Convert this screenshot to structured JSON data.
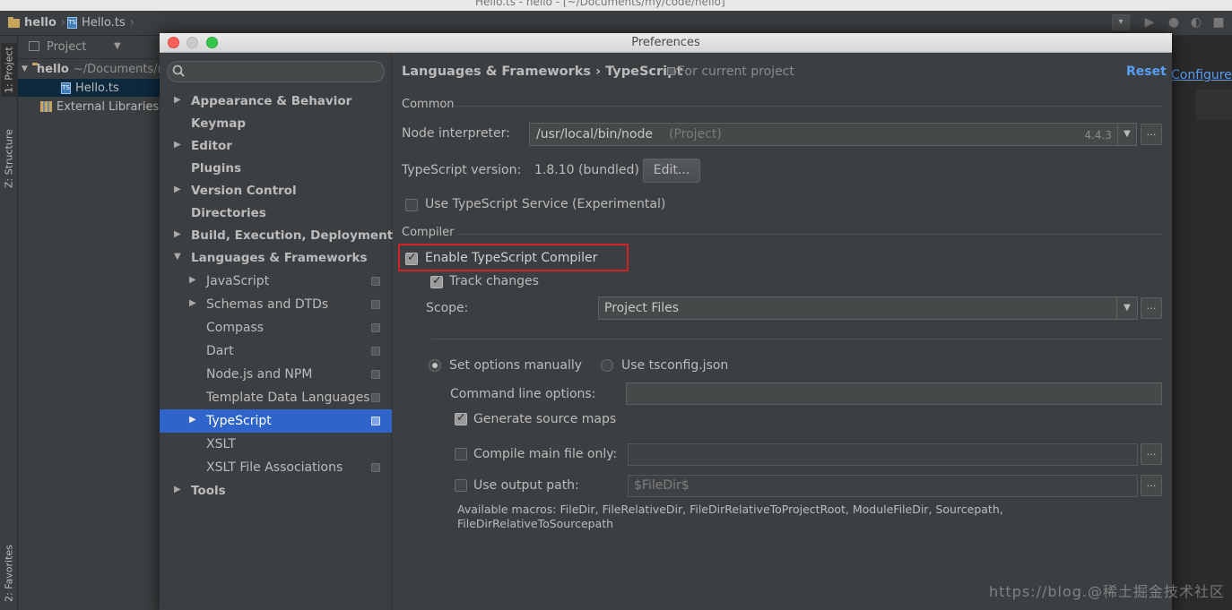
{
  "os_window": {
    "title": "Hello.ts - hello - [~/Documents/my/code/hello]"
  },
  "ide": {
    "breadcrumbs": [
      {
        "label": "hello"
      },
      {
        "label": "Hello.ts"
      }
    ],
    "left_tabs": {
      "project": "1: Project",
      "structure": "Z: Structure",
      "favorites": "2: Favorites"
    },
    "project_panel": {
      "header": "Project",
      "tree": {
        "root_name": "hello",
        "root_path": "~/Documents/my/code/hello",
        "file": "Hello.ts",
        "libraries": "External Libraries"
      }
    },
    "configure_link": "Configure"
  },
  "dialog": {
    "title": "Preferences",
    "sidebar": {
      "items": [
        {
          "label": "Appearance & Behavior"
        },
        {
          "label": "Keymap"
        },
        {
          "label": "Editor"
        },
        {
          "label": "Plugins"
        },
        {
          "label": "Version Control"
        },
        {
          "label": "Directories"
        },
        {
          "label": "Build, Execution, Deployment"
        },
        {
          "label": "Languages & Frameworks"
        },
        {
          "label": "JavaScript"
        },
        {
          "label": "Schemas and DTDs"
        },
        {
          "label": "Compass"
        },
        {
          "label": "Dart"
        },
        {
          "label": "Node.js and NPM"
        },
        {
          "label": "Template Data Languages"
        },
        {
          "label": "TypeScript"
        },
        {
          "label": "XSLT"
        },
        {
          "label": "XSLT File Associations"
        },
        {
          "label": "Tools"
        }
      ],
      "selected": "TypeScript"
    },
    "content": {
      "breadcrumb": "Languages & Frameworks › TypeScript",
      "scope_note": "For current project",
      "reset_label": "Reset",
      "common_header": "Common",
      "node_label": "Node interpreter:",
      "node_value": "/usr/local/bin/node",
      "node_scope": "(Project)",
      "node_version": "4.4.3",
      "ts_version_label": "TypeScript version:",
      "ts_version_value": "1.8.10 (bundled)",
      "edit_label": "Edit...",
      "use_service_label": "Use TypeScript Service (Experimental)",
      "compiler_header": "Compiler",
      "enable_compiler_label": "Enable TypeScript Compiler",
      "track_changes_label": "Track changes",
      "scope_label": "Scope:",
      "scope_value": "Project Files",
      "set_manually_label": "Set options manually",
      "use_tsconfig_label": "Use tsconfig.json",
      "cmd_options_label": "Command line options:",
      "cmd_options_value": "",
      "gen_maps_label": "Generate source maps",
      "compile_main_label": "Compile main file only:",
      "compile_main_value": "",
      "output_path_label": "Use output path:",
      "output_path_value": "$FileDir$",
      "macros_line1": "Available macros: FileDir, FileRelativeDir, FileDirRelativeToProjectRoot, ModuleFileDir, Sourcepath,",
      "macros_line2": "FileDirRelativeToSourcepath",
      "state": {
        "use_service": false,
        "enable_compiler": true,
        "track_changes": true,
        "set_manually": true,
        "use_tsconfig": false,
        "gen_maps": true,
        "compile_main": false,
        "output_path": false
      }
    }
  },
  "watermark": "https://blog.@稀土掘金技术社区",
  "colors": {
    "selection": "#2f65ca",
    "link": "#589df6",
    "highlight_box": "#d32226",
    "panel_bg": "#3c3f41"
  }
}
